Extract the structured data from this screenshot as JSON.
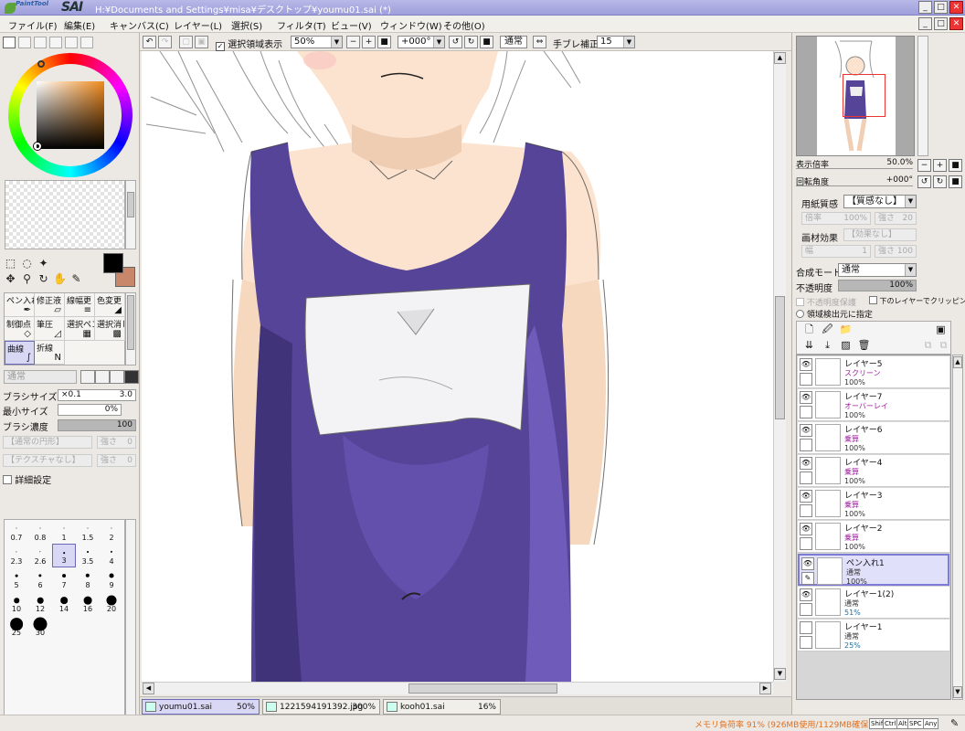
{
  "window": {
    "app_name": "Paint Tool SAI",
    "title": "H:¥Documents and Settings¥misa¥デスクトップ¥youmu01.sai (*)"
  },
  "menu": [
    "ファイル(F)",
    "編集(E)",
    "キャンバス(C)",
    "レイヤー(L)",
    "選択(S)",
    "フィルタ(T)",
    "ビュー(V)",
    "ウィンドウ(W)",
    "その他(O)"
  ],
  "canvas_toolbar": {
    "show_selection_label": "選択領域表示",
    "show_selection_checked": true,
    "zoom": "50%",
    "rotation": "+000°",
    "blend_mode": "通常",
    "stabilizer_label": "手ブレ補正",
    "stabilizer_value": "15"
  },
  "colors": {
    "foreground": "#000000",
    "background": "#c8876a",
    "accent": "#6a6ab8",
    "memory_text": "#e07020"
  },
  "tools": {
    "brushes": [
      {
        "label": "ペン入れ",
        "icon": "pen-icon"
      },
      {
        "label": "修正液",
        "icon": "eraser-icon"
      },
      {
        "label": "線幅更",
        "icon": "line-width-icon"
      },
      {
        "label": "色変更",
        "icon": "color-change-icon"
      },
      {
        "label": "制御点",
        "icon": "control-point-icon"
      },
      {
        "label": "筆圧",
        "icon": "pressure-icon"
      },
      {
        "label": "選択ペン",
        "icon": "select-pen-icon"
      },
      {
        "label": "選択消し",
        "icon": "select-erase-icon"
      },
      {
        "label": "曲線",
        "icon": "curve-icon"
      },
      {
        "label": "折線",
        "icon": "polyline-icon"
      }
    ],
    "active_brush": "曲線"
  },
  "brush_settings": {
    "mode": "通常",
    "size_label": "ブラシサイズ",
    "size_multiplier": "×0.1",
    "size_value": "3.0",
    "min_size_label": "最小サイズ",
    "min_size_value": "0%",
    "density_label": "ブラシ濃度",
    "density_value": "100",
    "shape_box": "【通常の円形】",
    "texture_box": "【テクスチャなし】",
    "strength_label": "強さ",
    "strength_value": "0",
    "detail_label": "詳細設定"
  },
  "brush_sizes": [
    "0.7",
    "0.8",
    "1",
    "1.5",
    "2",
    "2.3",
    "2.6",
    "3",
    "3.5",
    "4",
    "5",
    "6",
    "7",
    "8",
    "9",
    "10",
    "12",
    "14",
    "16",
    "20",
    "25",
    "30"
  ],
  "selected_brush_size": "3",
  "navigator": {
    "zoom_label": "表示倍率",
    "zoom_value": "50.0%",
    "rotation_label": "回転角度",
    "rotation_value": "+000°"
  },
  "layer_props": {
    "paper_texture_label": "用紙質感",
    "paper_texture_value": "【質感なし】",
    "paper_scale_label": "倍率",
    "paper_scale_value": "100%",
    "paper_strength_label": "強さ",
    "paper_strength_value": "20",
    "effect_label": "画材効果",
    "effect_value": "【効果なし】",
    "effect_width_label": "幅",
    "effect_width_value": "1",
    "effect_strength_label": "強さ",
    "effect_strength_value": "100",
    "blend_label": "合成モード",
    "blend_value": "通常",
    "opacity_label": "不透明度",
    "opacity_value": "100%",
    "protect_opacity_label": "不透明度保護",
    "clip_label": "下のレイヤーでクリッピング",
    "selection_source_label": "領域検出元に指定"
  },
  "layers": [
    {
      "name": "レイヤー5",
      "mode": "スクリーン",
      "opacity": "100%",
      "active": false,
      "visible": true,
      "mode_color": "#a020a0"
    },
    {
      "name": "レイヤー7",
      "mode": "オーバーレイ",
      "opacity": "100%",
      "active": false,
      "visible": true,
      "mode_color": "#a020a0"
    },
    {
      "name": "レイヤー6",
      "mode": "乗算",
      "opacity": "100%",
      "active": false,
      "visible": true,
      "mode_color": "#a020a0"
    },
    {
      "name": "レイヤー4",
      "mode": "乗算",
      "opacity": "100%",
      "active": false,
      "visible": true,
      "mode_color": "#a020a0"
    },
    {
      "name": "レイヤー3",
      "mode": "乗算",
      "opacity": "100%",
      "active": false,
      "visible": true,
      "mode_color": "#a020a0"
    },
    {
      "name": "レイヤー2",
      "mode": "乗算",
      "opacity": "100%",
      "active": false,
      "visible": true,
      "mode_color": "#a020a0"
    },
    {
      "name": "ペン入れ1",
      "mode": "通常",
      "opacity": "100%",
      "active": true,
      "visible": true,
      "mode_color": "#333333"
    },
    {
      "name": "レイヤー1(2)",
      "mode": "通常",
      "opacity": "51%",
      "active": false,
      "visible": true,
      "mode_color": "#333333"
    },
    {
      "name": "レイヤー1",
      "mode": "通常",
      "opacity": "25%",
      "active": false,
      "visible": false,
      "mode_color": "#333333"
    }
  ],
  "documents": [
    {
      "name": "youmu01.sai",
      "zoom": "50%",
      "active": true
    },
    {
      "name": "1221594191392.jpg",
      "zoom": "300%",
      "active": false
    },
    {
      "name": "kooh01.sai",
      "zoom": "16%",
      "active": false
    }
  ],
  "status": {
    "memory": "メモリ負荷率 91% (926MB使用/1129MB確保)",
    "keys": [
      "Shift",
      "Ctrl",
      "Alt",
      "SPC",
      "Any"
    ]
  }
}
